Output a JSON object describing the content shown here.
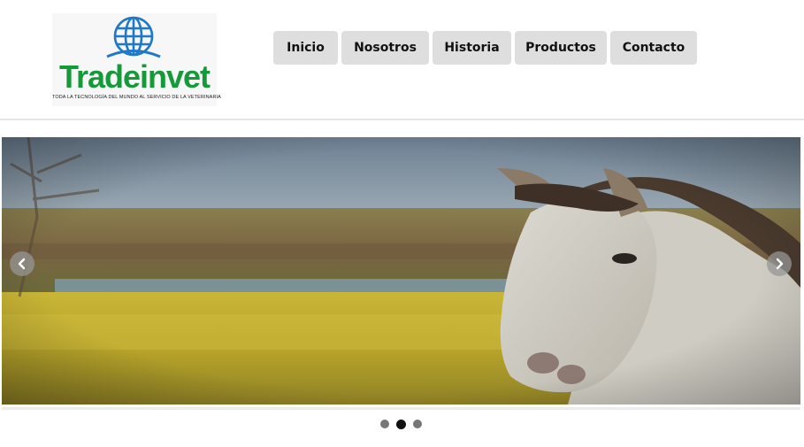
{
  "brand": {
    "name": "Tradeinvet",
    "tagline": "TODA LA TECNOLOGÍA DEL MUNDO AL SERVICIO DE LA VETERINARIA",
    "word_color": "#159a3a",
    "globe_color": "#1f78c8"
  },
  "nav": {
    "items": [
      {
        "label": "Inicio"
      },
      {
        "label": "Nosotros"
      },
      {
        "label": "Historia"
      },
      {
        "label": "Productos"
      },
      {
        "label": "Contacto"
      }
    ]
  },
  "slider": {
    "prev_icon": "chevron-left-icon",
    "next_icon": "chevron-right-icon",
    "slide_count": 3,
    "active_slide": 2
  }
}
